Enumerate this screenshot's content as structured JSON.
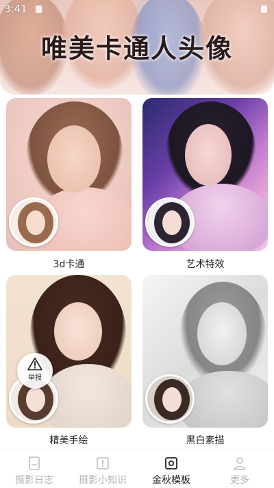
{
  "status_bar": {
    "time": "3:41"
  },
  "banner": {
    "title": "唯美卡通人头像"
  },
  "cards": [
    {
      "label": "3d卡通"
    },
    {
      "label": "艺术特效"
    },
    {
      "label": "精美手绘"
    },
    {
      "label": "黑白素描"
    }
  ],
  "report_button": {
    "label": "举报",
    "icon": "warning-triangle-icon"
  },
  "bottom_nav": {
    "active_index": 2,
    "items": [
      {
        "label": "摄影日志",
        "icon": "journal-icon"
      },
      {
        "label": "摄影小知识",
        "icon": "info-card-icon"
      },
      {
        "label": "金秋模板",
        "icon": "template-icon"
      },
      {
        "label": "更多",
        "icon": "person-icon"
      }
    ]
  },
  "colors": {
    "active_nav": "#222222",
    "inactive_nav": "#b5b5b5",
    "card_label": "#222222"
  }
}
